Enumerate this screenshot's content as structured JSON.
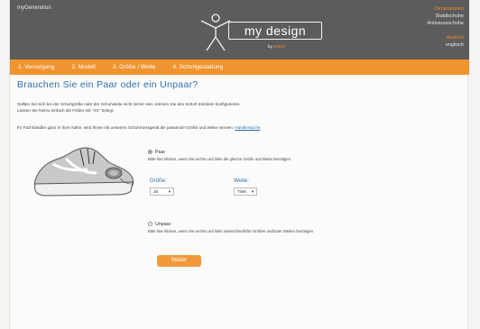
{
  "header": {
    "left_text": "myGeneration",
    "right": {
      "line1": "Dimensionen",
      "line2": "Stabilschuhe",
      "line3": "Antivarusschuhe",
      "line4": "deutsch",
      "line5": "englisch"
    },
    "logo": {
      "name": "my design",
      "by_prefix": "by",
      "by_brand": "schein"
    }
  },
  "nav": {
    "items": [
      "1. Versorgung",
      "2. Modell",
      "3. Größe / Weite",
      "4. Schuhgestaltung"
    ]
  },
  "main": {
    "title": "Brauchen Sie ein Paar oder ein Unpaar?",
    "intro1": "Sollten Sie sich bei der Schuhgröße oder der Schuhweite nicht sicher sein, können Sie den Schuh trotzdem konfigurieren.",
    "intro2": "Lassen Sie hierzu einfach die Felder mit \"XX\" belegt.",
    "dealer_text": "Ihr Fachhändler ganz in Ihrer Nähe, wird Ihnen mit unserem Schuhmessgerät die passende Größe und Weite nennen:",
    "dealer_link": "Händlersuche",
    "paar": {
      "label": "Paar",
      "desc": "Bitte hier klicken, wenn Sie rechts und links die gleiche Größe und Weite benötigen",
      "size_label": "Größe:",
      "size_value": "28",
      "width_label": "Weite:",
      "width_value": "TW8"
    },
    "unpaar": {
      "label": "Unpaar",
      "desc": "Bitte hier klicken, wenn Sie rechts und links unterschiedliche Größen und/oder Weiten benötigen"
    },
    "next_button": "Weiter"
  },
  "colors": {
    "accent": "#f0942f",
    "header_bg": "#5c5c5c",
    "title_blue": "#2e6fae"
  }
}
